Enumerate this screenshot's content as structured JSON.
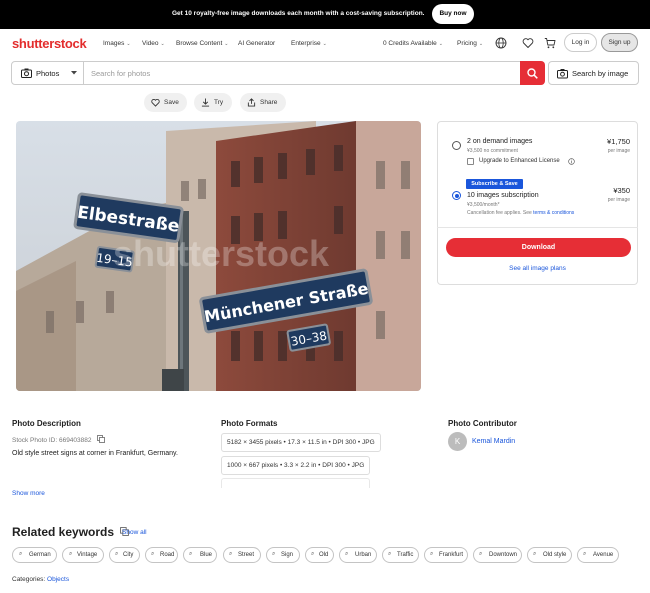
{
  "promo": {
    "text": "Get 10 royalty-free image downloads each month with a cost-saving subscription.",
    "button": "Buy now"
  },
  "nav": {
    "logo": "shutterstock",
    "menu": [
      "Images",
      "Video",
      "Browse Content",
      "AI Generator",
      "Enterprise"
    ],
    "credits": "0 Credits Available",
    "pricing": "Pricing",
    "login": "Log in",
    "signup": "Sign up",
    "icons": [
      "globe-icon",
      "heart-icon",
      "cart-icon"
    ]
  },
  "search": {
    "type": "Photos",
    "placeholder": "Search for photos",
    "by_image": "Search by image"
  },
  "actions": {
    "save": "Save",
    "try": "Try",
    "share": "Share"
  },
  "photo": {
    "watermark": "shutterstock",
    "sign1": "Elbestraße",
    "num1": "19–15",
    "sign2": "Münchener Straße",
    "num2": "30–38"
  },
  "license": {
    "option1": {
      "title": "2 on demand images",
      "sub": "¥3,500 no commitment",
      "price": "¥1,750",
      "per": "per image"
    },
    "enhanced": "Upgrade to Enhanced License",
    "option2": {
      "badge": "Subscribe & Save",
      "title": "10 images subscription",
      "sub": "¥3,500/month*",
      "price": "¥350",
      "per": "per image"
    },
    "fee_prefix": "Cancellation fee applies. See ",
    "fee_link": "terms & conditions",
    "download": "Download",
    "see_all": "See all image plans"
  },
  "details": {
    "desc_heading": "Photo Description",
    "stock_id": "Stock Photo ID: 669403882",
    "description": "Old style street signs at corner in Frankfurt, Germany.",
    "show_more": "Show more",
    "formats_heading": "Photo Formats",
    "formats": [
      "5182 × 3455 pixels • 17.3 × 11.5 in • DPI 300 • JPG",
      "1000 × 667 pixels • 3.3 × 2.2 in • DPI 300 • JPG"
    ],
    "contributor_heading": "Photo Contributor",
    "avatar_initial": "K",
    "contributor": "Kemal Mardin"
  },
  "related": {
    "heading": "Related keywords",
    "show_all": "Show all",
    "keywords": [
      "German",
      "Vintage",
      "City",
      "Road",
      "Blue",
      "Street",
      "Sign",
      "Old",
      "Urban",
      "Traffic",
      "Frankfurt",
      "Downtown",
      "Old style",
      "Avenue"
    ],
    "categories_label": "Categories: ",
    "category": "Objects"
  },
  "colors": {
    "brand": "#e62e36",
    "link": "#1a56db",
    "promo_bg": "#000000"
  }
}
